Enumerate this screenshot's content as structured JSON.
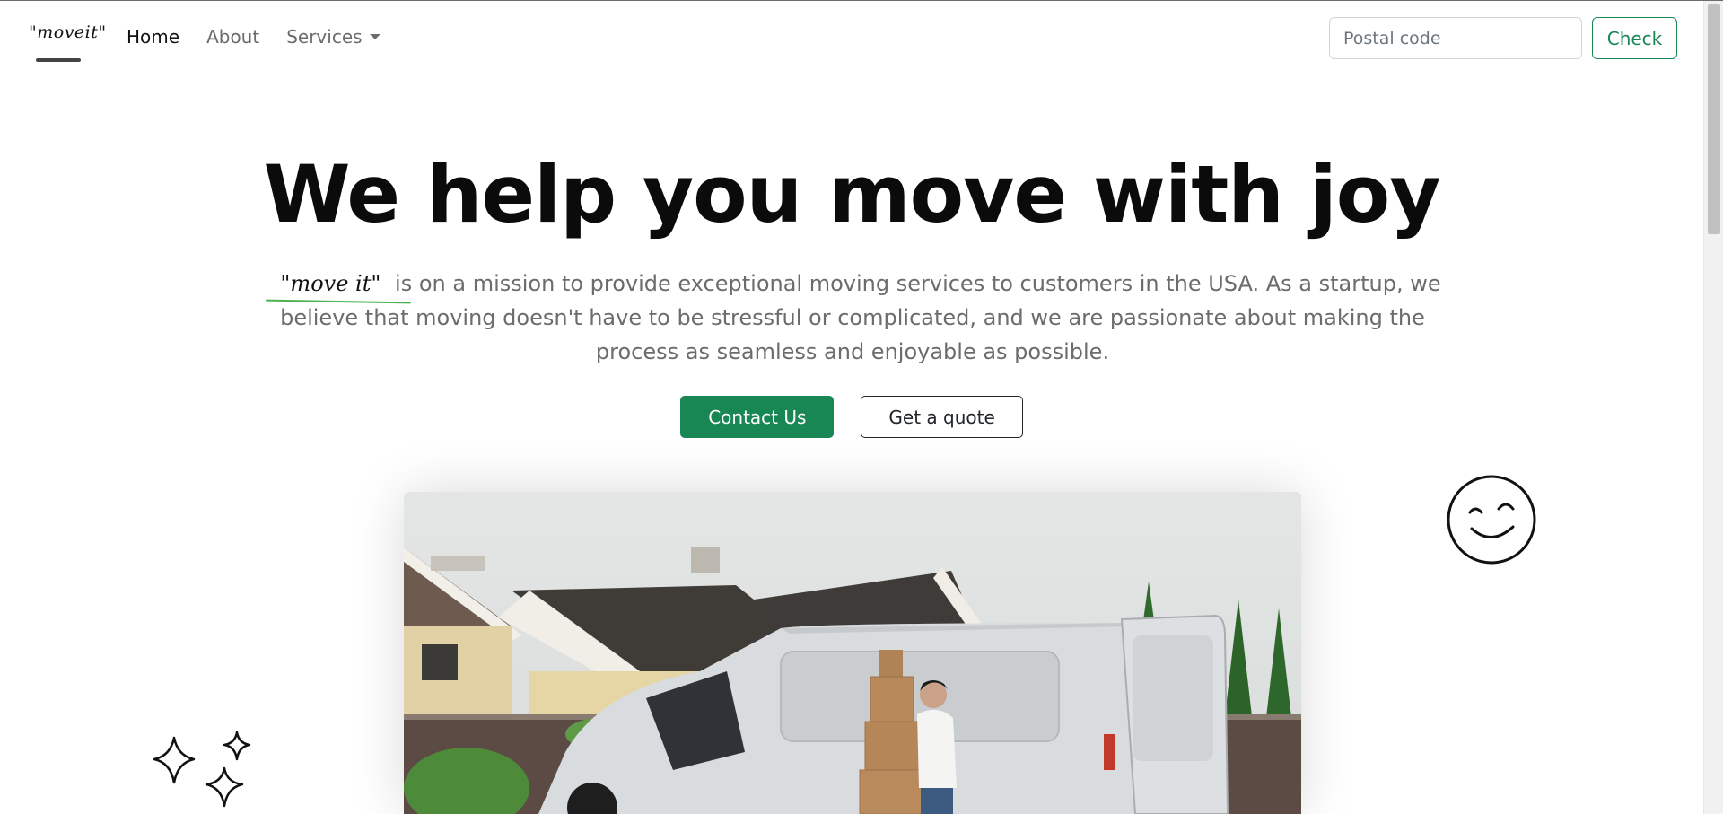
{
  "navbar": {
    "brand": "\"moveit\"",
    "links": [
      {
        "label": "Home",
        "active": true
      },
      {
        "label": "About",
        "active": false
      },
      {
        "label": "Services",
        "active": false
      }
    ],
    "postal_placeholder": "Postal code",
    "check_label": "Check"
  },
  "hero": {
    "title": "We help you move with joy",
    "brand_inline": "\"move it\"",
    "lead": "is on a mission to provide exceptional moving services to customers in the USA. As a startup, we believe that moving doesn't have to be stressful or complicated, and we are passionate about making the process as seamless and enjoyable as possible.",
    "contact_label": "Contact Us",
    "quote_label": "Get a quote"
  },
  "colors": {
    "accent": "#198754",
    "text_muted": "#6c6c6c",
    "heading": "#0b0b0b"
  },
  "icons": [
    "smiley-icon",
    "sparkles-icon",
    "caret-down-icon"
  ]
}
